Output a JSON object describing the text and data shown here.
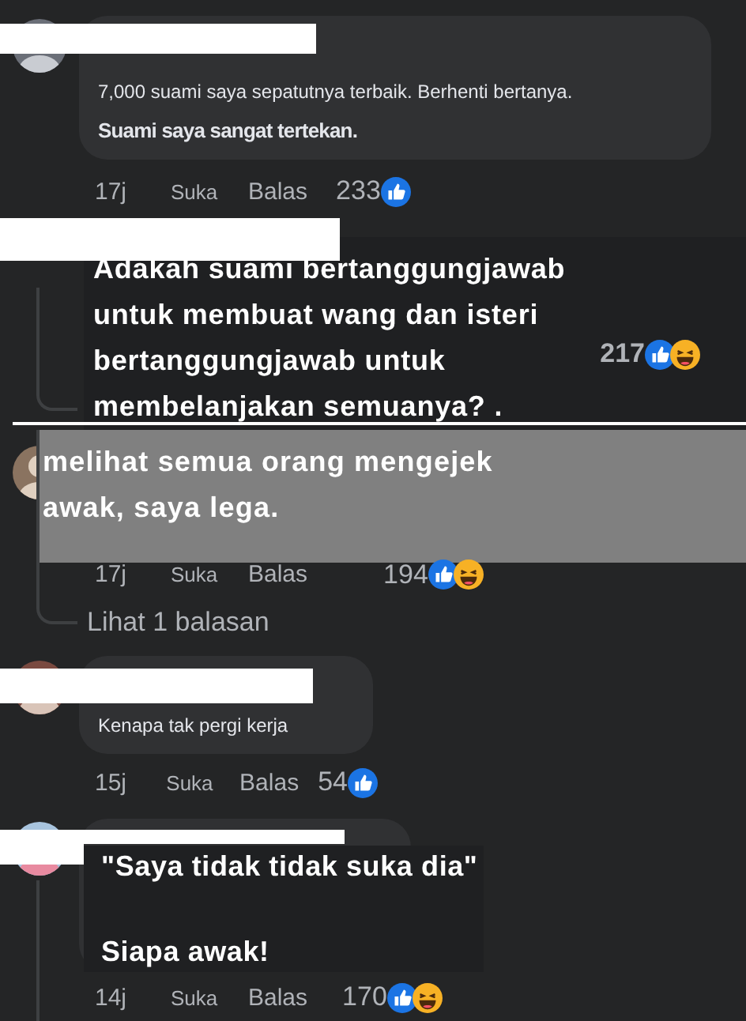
{
  "comments": [
    {
      "kind": "plain",
      "lines": [
        "7,000 suami saya sepatutnya terbaik. Berhenti bertanya.",
        "Suami saya sangat tertekan."
      ],
      "time": "17j",
      "like": "Suka",
      "reply": "Balas",
      "count": "233",
      "reactions": [
        {
          "kind": "like"
        }
      ]
    },
    {
      "kind": "dark_caption",
      "lines": [
        "Adakah suami bertanggungjawab untuk membuat wang dan isteri bertanggungjawab untuk membelanjakan semuanya? ."
      ],
      "count": "217",
      "reactions": [
        {
          "kind": "like"
        },
        {
          "kind": "haha"
        }
      ]
    },
    {
      "kind": "grey_caption",
      "lines": [
        "melihat semua orang mengejek awak, saya lega."
      ],
      "time": "17j",
      "like": "Suka",
      "reply": "Balas",
      "count": "194",
      "reactions": [
        {
          "kind": "like"
        },
        {
          "kind": "haha"
        }
      ],
      "replies_link": "Lihat 1 balasan"
    },
    {
      "kind": "plain",
      "lines": [
        "Kenapa tak pergi kerja"
      ],
      "time": "15j",
      "like": "Suka",
      "reply": "Balas",
      "count": "54",
      "reactions": [
        {
          "kind": "like"
        }
      ]
    },
    {
      "kind": "dark_caption",
      "lines": [
        "\"Saya tidak tidak suka dia\"",
        "Siapa awak!"
      ],
      "time": "14j",
      "like": "Suka",
      "reply": "Balas",
      "count": "170",
      "reactions": [
        {
          "kind": "like"
        },
        {
          "kind": "haha"
        }
      ]
    }
  ]
}
